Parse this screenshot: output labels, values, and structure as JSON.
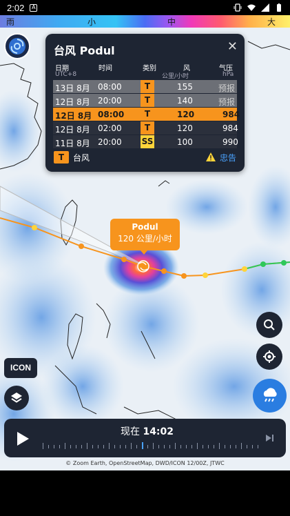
{
  "status_bar": {
    "time": "2:02"
  },
  "legend": {
    "rain": "雨",
    "small": "小",
    "medium": "中",
    "large": "大"
  },
  "storm_card": {
    "title": "台风 Podul",
    "columns": {
      "date": "日期",
      "date_sub": "UTC+8",
      "time": "时间",
      "category": "类别",
      "wind": "风",
      "wind_unit": "公里/小时",
      "pressure": "气压",
      "pressure_unit": "hPa"
    },
    "rows": [
      {
        "date": "13日 8月",
        "time": "08:00",
        "category": "T",
        "wind": "155",
        "pressure": "预报",
        "style": "forecast"
      },
      {
        "date": "12日 8月",
        "time": "20:00",
        "category": "T",
        "wind": "140",
        "pressure": "预报",
        "style": "forecast"
      },
      {
        "date": "12日 8月",
        "time": "08:00",
        "category": "T",
        "wind": "120",
        "pressure": "984",
        "style": "selected"
      },
      {
        "date": "12日 8月",
        "time": "02:00",
        "category": "T",
        "wind": "120",
        "pressure": "984",
        "style": "past"
      },
      {
        "date": "11日 8月",
        "time": "20:00",
        "category": "SS",
        "wind": "100",
        "pressure": "990",
        "style": "past"
      }
    ],
    "legend_badge": "T",
    "legend_label": "台风",
    "warning_link": "忠告"
  },
  "callout": {
    "name": "Podul",
    "speed": "120 公里/小时"
  },
  "model_button": {
    "label": "ICON"
  },
  "timeline": {
    "now_prefix": "现在",
    "now_time": "14:02"
  },
  "credits": "© Zoom Earth, OpenStreetMap, DWD/ICON 12/00Z, JTWC",
  "colors": {
    "accent": "#f7941d",
    "panel": "#1e2533",
    "tropical_storm": "#ffd43a",
    "link": "#4aa3ff",
    "rain_button": "#2a7de1"
  }
}
